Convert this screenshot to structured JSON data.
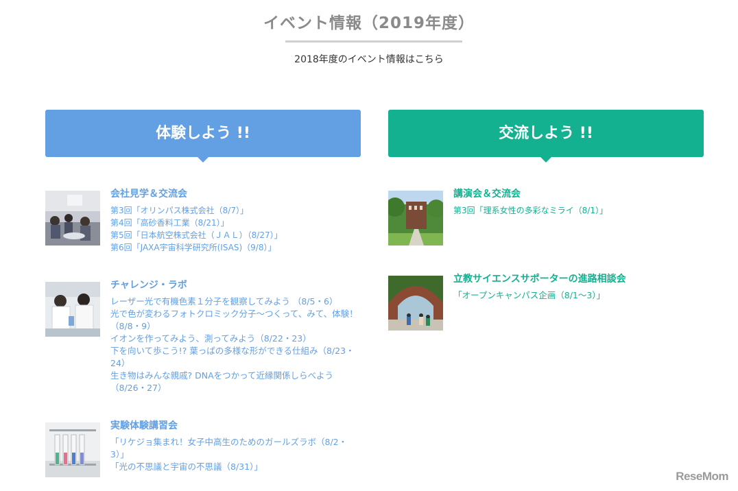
{
  "header": {
    "title": "イベント情報（2019年度）",
    "prev_link": "2018年度のイベント情報はこちら"
  },
  "banners": {
    "left": "体験しよう !!",
    "right": "交流しよう !!"
  },
  "left_events": [
    {
      "title": "会社見学＆交流会",
      "links": [
        "第3回「オリンパス株式会社（8/7）」",
        "第4回「高砂香料工業（8/21）」",
        "第5回「日本航空株式会社（ＪＡＬ）（8/27）」",
        "第6回「JAXA宇宙科学研究所(ISAS)（9/8）」"
      ]
    },
    {
      "title": "チャレンジ・ラボ",
      "links": [
        "レーザー光で有機色素１分子を観察してみよう （8/5・6）",
        "光で色が変わるフォトクロミック分子～つくって、みて、体験！（8/8・9）",
        "イオンを作ってみよう、測ってみよう（8/22・23）",
        "下を向いて歩こう!? 葉っぱの多様な形ができる仕組み（8/23・24）",
        "生き物はみんな親戚? DNAをつかって近縁関係しらべよう（8/26・27）"
      ]
    },
    {
      "title": "実験体験講習会",
      "links": [
        "「リケジョ集まれ！女子中高生のためのガールズラボ（8/2・3）」",
        "「光の不思議と宇宙の不思議（8/31）」"
      ]
    }
  ],
  "right_events": [
    {
      "title": "講演会＆交流会",
      "links": [
        "第3回「理系女性の多彩なミライ（8/1）」"
      ]
    },
    {
      "title": "立教サイエンスサポーターの進路相談会",
      "links": [
        "「オープンキャンパス企画（8/1～3）」"
      ]
    }
  ],
  "logo": "ReseMom"
}
